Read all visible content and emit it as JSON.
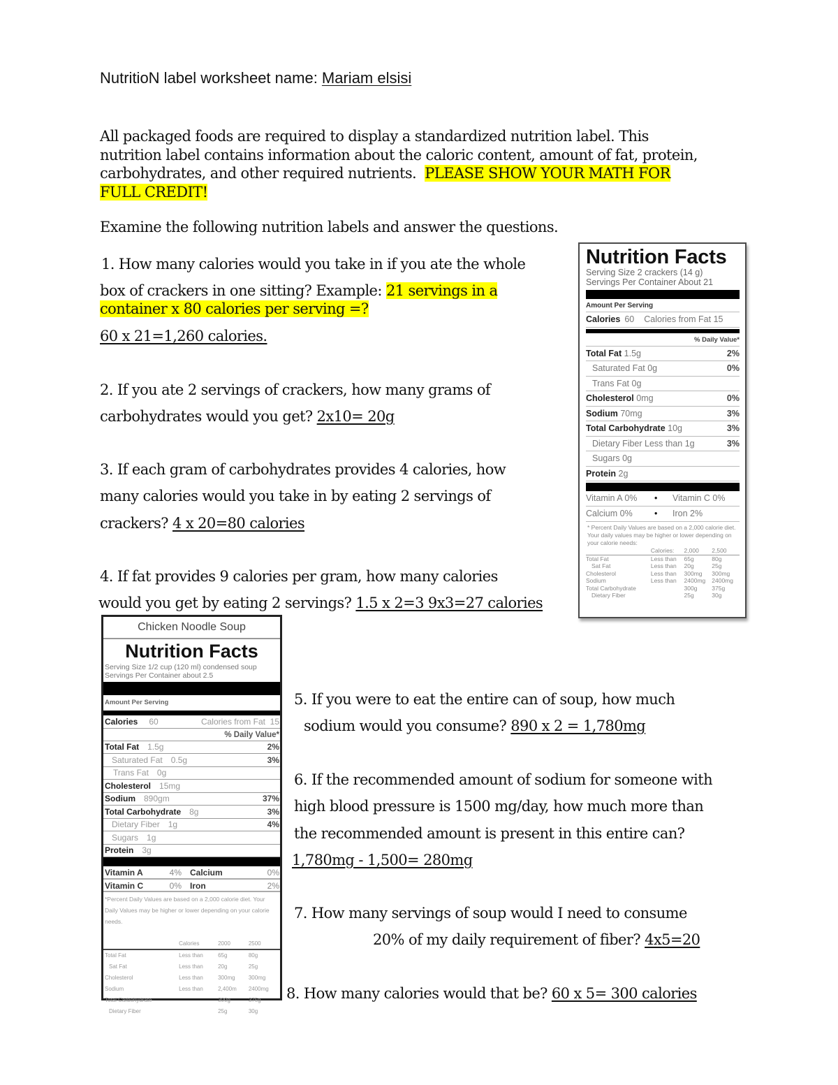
{
  "header": {
    "prefix": "NutritioN label worksheet name: ",
    "student_name": "Mariam elsisi"
  },
  "intro": {
    "line1": "All packaged foods are required to display a standardized nutrition label. This",
    "line2": "nutrition label contains information about the caloric content, amount of fat, protein,",
    "line3_text": "carbohydrates, and other required nutrients.  ",
    "line3_highlight": "PLEASE SHOW YOUR MATH FOR",
    "line4_highlight": "FULL CREDIT!",
    "highlight_color": "#ffff00"
  },
  "instruction": "Examine the following nutrition labels and answer the questions.",
  "questions": [
    {
      "number": "1.",
      "lines": [
        "How many calories would you take in if you ate the whole"
      ],
      "line2_text": "box of crackers in one sitting? Example: ",
      "line2_highlight": "21 servings in a",
      "line3_highlight": "container x 80 calories per serving =?",
      "answer": "60 x 21=1,260 calories."
    },
    {
      "number": "2.",
      "line1": "If you ate 2 servings of crackers, how many grams of",
      "line2": "carbohydrates would you get? ",
      "answer": "2x10= 20g"
    },
    {
      "number": "3.",
      "line1": "If each gram of carbohydrates provides 4 calories, how",
      "line2": "many calories would you take in by eating 2 servings of",
      "line3": "crackers? ",
      "answer": "4 x 20=80 calories"
    },
    {
      "number": "4.",
      "line1": "If fat provides 9 calories per gram, how many calories",
      "line2": "would you get by eating 2 servings? ",
      "answer": "1.5 x 2=3 9x3=27 calories"
    },
    {
      "number": "5.",
      "line1": "If you were to eat the entire can of soup, how much",
      "line2": "sodium would you consume? ",
      "answer": "890 x 2 = 1,780mg"
    },
    {
      "number": "6.",
      "line1": "If the recommended amount of sodium for someone with",
      "line2": "high blood pressure is 1500 mg/day, how much more than",
      "line3": "the recommended amount is present in this entire can?",
      "answer": "1,780mg - 1,500= 280mg"
    },
    {
      "number": "7.",
      "line1": "How many servings of soup would I need to consume",
      "line2": "20% of my daily requirement of fiber? ",
      "answer": "4x5=20"
    },
    {
      "number": "8.",
      "line1": "How many calories would that be? ",
      "answer": "60 x 5= 300 calories"
    }
  ],
  "cracker_label": {
    "title": "Nutrition Facts",
    "serving_size": "Serving Size 2 crackers (14 g)",
    "servings_per_container": "Servings Per Container About 21",
    "amount_per_serving": "Amount Per Serving",
    "calories_label": "Calories",
    "calories_value": "60",
    "calories_from_fat": "Calories from Fat 15",
    "daily_value_header": "% Daily Value*",
    "rows": [
      {
        "label": "Total Fat",
        "value": "1.5g",
        "pct": "2%",
        "bold": true,
        "indent": false
      },
      {
        "label": "Saturated Fat",
        "value": "0g",
        "pct": "0%",
        "bold": false,
        "indent": true
      },
      {
        "label": "Trans Fat",
        "value": "0g",
        "pct": "",
        "bold": false,
        "indent": true
      },
      {
        "label": "Cholesterol",
        "value": "0mg",
        "pct": "0%",
        "bold": true,
        "indent": false
      },
      {
        "label": "Sodium",
        "value": "70mg",
        "pct": "3%",
        "bold": true,
        "indent": false
      },
      {
        "label": "Total Carbohydrate",
        "value": "10g",
        "pct": "3%",
        "bold": true,
        "indent": false
      },
      {
        "label": "Dietary Fiber",
        "value": "Less than 1g",
        "pct": "3%",
        "bold": false,
        "indent": true
      },
      {
        "label": "Sugars",
        "value": "0g",
        "pct": "",
        "bold": false,
        "indent": true
      },
      {
        "label": "Protein",
        "value": "2g",
        "pct": "",
        "bold": true,
        "indent": false
      }
    ],
    "vitamins": [
      {
        "left": "Vitamin A 0%",
        "right": "Vitamin C 0%"
      },
      {
        "left": "Calcium 0%",
        "right": "Iron 2%"
      }
    ],
    "bullet": "•",
    "footnote": "* Percent Daily Values are based on a 2,000 calorie diet. Your daily values may be higher or lower depending on your calorie needs:",
    "footnote_table": {
      "header": [
        "",
        "Calories:",
        "2,000",
        "2,500"
      ],
      "rows": [
        [
          "Total Fat",
          "Less than",
          "65g",
          "80g"
        ],
        [
          "Sat Fat",
          "Less than",
          "20g",
          "25g"
        ],
        [
          "Cholesterol",
          "Less than",
          "300mg",
          "300mg"
        ],
        [
          "Sodium",
          "Less than",
          "2400mg",
          "2400mg"
        ],
        [
          "Total Carbohydrate",
          "",
          "300g",
          "375g"
        ],
        [
          "Dietary Fiber",
          "",
          "25g",
          "30g"
        ]
      ]
    }
  },
  "soup_label": {
    "product_name": "Chicken Noodle Soup",
    "title": "Nutrition Facts",
    "serving_size": "Serving Size 1/2 cup (120 ml) condensed soup",
    "servings_per_container": "Servings Per Container  about 2.5",
    "amount_per_serving": "Amount Per Serving",
    "calories_label": "Calories",
    "calories_value": "60",
    "calories_from_fat": "Calories from Fat  15",
    "daily_value_header": "% Daily Value*",
    "rows": [
      {
        "label": "Total Fat",
        "value": "1.5g",
        "pct": "2%",
        "bold": true,
        "indent": ""
      },
      {
        "label": "Saturated Fat",
        "value": "0.5g",
        "pct": "3%",
        "bold": false,
        "indent": "i1"
      },
      {
        "label": "Trans Fat",
        "value": "0g",
        "pct": "",
        "bold": false,
        "indent": "i2"
      },
      {
        "label": "Cholesterol",
        "value": "15mg",
        "pct": "",
        "bold": true,
        "indent": ""
      },
      {
        "label": "Sodium",
        "value": "890gm",
        "pct": "37%",
        "bold": true,
        "indent": ""
      },
      {
        "label": "Total Carbohydrate",
        "value": "8g",
        "pct": "3%",
        "bold": true,
        "indent": ""
      },
      {
        "label": "Dietary Fiber",
        "value": "1g",
        "pct": "4%",
        "bold": false,
        "indent": "i1"
      },
      {
        "label": "Sugars",
        "value": "1g",
        "pct": "",
        "bold": false,
        "indent": "i1"
      },
      {
        "label": "Protein",
        "value": "3g",
        "pct": "",
        "bold": true,
        "indent": ""
      }
    ],
    "vitamins": [
      {
        "a_label": "Vitamin A",
        "a_pct": "4%",
        "b_label": "Calcium",
        "b_pct": "0%"
      },
      {
        "a_label": "Vitamin C",
        "a_pct": "0%",
        "b_label": "Iron",
        "b_pct": "2%"
      }
    ],
    "footnote": "*Percent Daily Values are based on a 2,000 calorie diet. Your Daily Values may be higher or lower depending on your calorie needs.",
    "footnote_table": {
      "header": [
        "",
        "Calories",
        "2000",
        "2500"
      ],
      "rows": [
        [
          "Total Fat",
          "Less than",
          "65g",
          "80g"
        ],
        [
          "Sat Fat",
          "Less than",
          "20g",
          "25g"
        ],
        [
          "Cholesterol",
          "Less than",
          "300mg",
          "300mg"
        ],
        [
          "Sodium",
          "Less than",
          "2,400m",
          "2400mg"
        ],
        [
          "Total Carbohydrate",
          "",
          "300g",
          "375g"
        ],
        [
          "Dietary Fiber",
          "",
          "25g",
          "30g"
        ]
      ]
    }
  }
}
